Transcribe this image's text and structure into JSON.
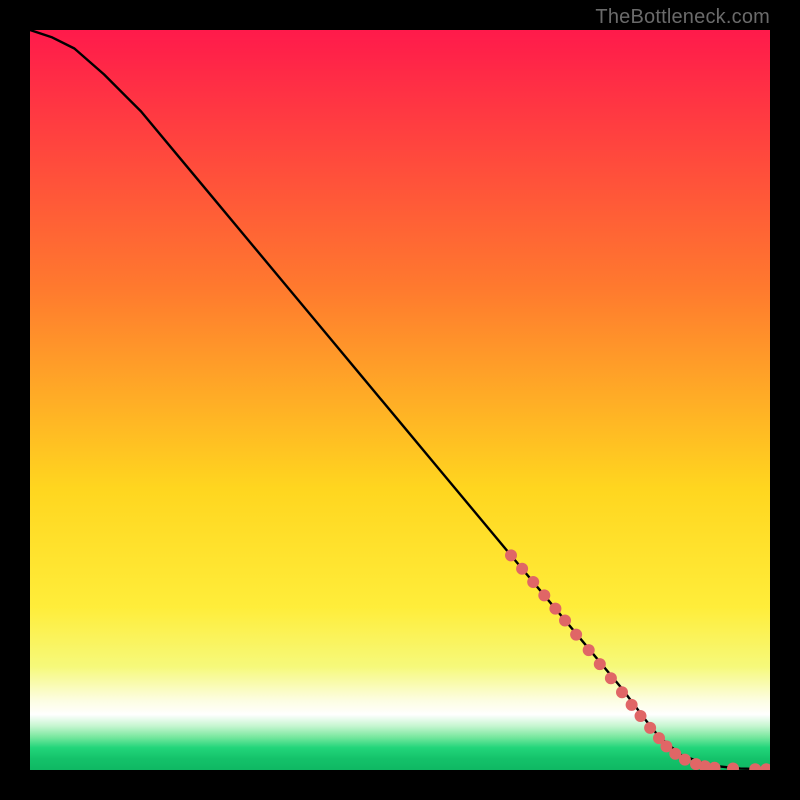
{
  "watermark": "TheBottleneck.com",
  "chart_data": {
    "type": "line",
    "title": "",
    "xlabel": "",
    "ylabel": "",
    "xlim": [
      0,
      100
    ],
    "ylim": [
      0,
      100
    ],
    "grid": false,
    "legend": false,
    "background_gradient": {
      "stops": [
        {
          "offset": 0.0,
          "color": "#ff1a4b"
        },
        {
          "offset": 0.35,
          "color": "#ff7a2e"
        },
        {
          "offset": 0.62,
          "color": "#ffd61f"
        },
        {
          "offset": 0.78,
          "color": "#ffed3a"
        },
        {
          "offset": 0.86,
          "color": "#f6f97a"
        },
        {
          "offset": 0.905,
          "color": "#fcfde0"
        },
        {
          "offset": 0.925,
          "color": "#ffffff"
        },
        {
          "offset": 0.94,
          "color": "#c8f6d2"
        },
        {
          "offset": 0.955,
          "color": "#7ae8a0"
        },
        {
          "offset": 0.97,
          "color": "#22d57a"
        },
        {
          "offset": 0.985,
          "color": "#14c26a"
        },
        {
          "offset": 1.0,
          "color": "#0fb863"
        }
      ]
    },
    "series": [
      {
        "name": "curve",
        "type": "line",
        "color": "#000000",
        "x": [
          0,
          3,
          6,
          10,
          15,
          20,
          25,
          30,
          35,
          40,
          45,
          50,
          55,
          60,
          65,
          70,
          75,
          80,
          83,
          85,
          88,
          92,
          96,
          100
        ],
        "y": [
          100,
          99,
          97.5,
          94,
          89,
          83,
          77,
          71,
          65,
          59,
          53,
          47,
          41,
          35,
          29,
          23,
          17,
          11,
          7,
          4.5,
          2,
          0.6,
          0.2,
          0.1
        ]
      },
      {
        "name": "highlight-dots",
        "type": "scatter",
        "color": "#e06666",
        "radius": 6,
        "points": [
          {
            "x": 65.0,
            "y": 29.0
          },
          {
            "x": 66.5,
            "y": 27.2
          },
          {
            "x": 68.0,
            "y": 25.4
          },
          {
            "x": 69.5,
            "y": 23.6
          },
          {
            "x": 71.0,
            "y": 21.8
          },
          {
            "x": 72.3,
            "y": 20.2
          },
          {
            "x": 73.8,
            "y": 18.3
          },
          {
            "x": 75.5,
            "y": 16.2
          },
          {
            "x": 77.0,
            "y": 14.3
          },
          {
            "x": 78.5,
            "y": 12.4
          },
          {
            "x": 80.0,
            "y": 10.5
          },
          {
            "x": 81.3,
            "y": 8.8
          },
          {
            "x": 82.5,
            "y": 7.3
          },
          {
            "x": 83.8,
            "y": 5.7
          },
          {
            "x": 85.0,
            "y": 4.3
          },
          {
            "x": 86.0,
            "y": 3.2
          },
          {
            "x": 87.2,
            "y": 2.2
          },
          {
            "x": 88.5,
            "y": 1.4
          },
          {
            "x": 90.0,
            "y": 0.8
          },
          {
            "x": 91.2,
            "y": 0.5
          },
          {
            "x": 92.5,
            "y": 0.3
          },
          {
            "x": 95.0,
            "y": 0.2
          },
          {
            "x": 98.0,
            "y": 0.1
          },
          {
            "x": 99.5,
            "y": 0.1
          }
        ]
      }
    ]
  }
}
